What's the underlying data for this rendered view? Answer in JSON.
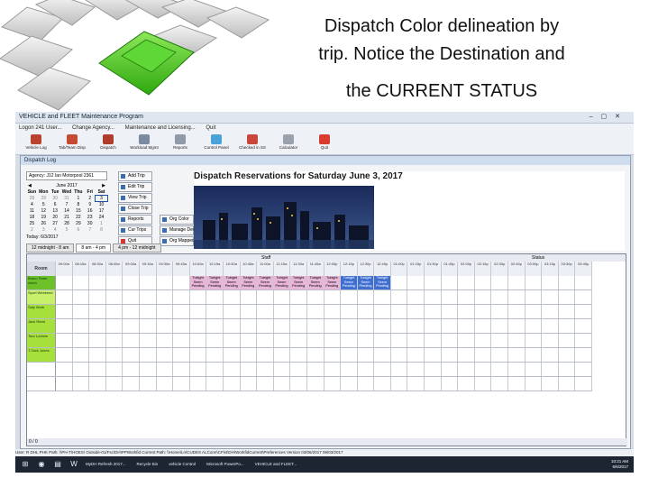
{
  "slide": {
    "title_line1": "Dispatch Color delineation by",
    "title_line2": "trip. Notice the Destination and",
    "title_line3": "the CURRENT STATUS"
  },
  "app": {
    "title": "VEHICLE and FLEET Maintenance Program",
    "menu": [
      "Logon 241 User...",
      "Change Agency...",
      "Maintenance and Licensing...",
      "Quit"
    ],
    "toolbar": [
      "Vehicle Log",
      "Tab/Team Disp",
      "Dispatch",
      "Workload Mgmt",
      "Reports",
      "Control Panel",
      "Checked in SS",
      "Calculator",
      "Quit"
    ]
  },
  "dispatch": {
    "window_title": "Dispatch Log",
    "agency": "Agency: J12 Ian Motorpool 2361",
    "month": "June 2017",
    "weekdays": [
      "Sun",
      "Mon",
      "Tue",
      "Wed",
      "Thu",
      "Fri",
      "Sat"
    ],
    "days": [
      "28",
      "29",
      "30",
      "31",
      "1",
      "2",
      "3",
      "4",
      "5",
      "6",
      "7",
      "8",
      "9",
      "10",
      "11",
      "12",
      "13",
      "14",
      "15",
      "16",
      "17",
      "18",
      "19",
      "20",
      "21",
      "22",
      "23",
      "24",
      "25",
      "26",
      "27",
      "28",
      "29",
      "30",
      "1",
      "2",
      "3",
      "4",
      "5",
      "6",
      "7",
      "8"
    ],
    "today_label": "Today: 6/3/2017",
    "buttons": [
      "Add Trip",
      "Edit Trip",
      "View Trip",
      "Close Trip",
      "Reports",
      "Org Color",
      "Cur Trips",
      "Manage Dev",
      "Quit",
      "Org Mapped"
    ],
    "heading": "Dispatch Reservations for Saturday",
    "heading_date": "June 3, 2017",
    "time_tabs": [
      "12 midnight - 8 am",
      "8 am - 4 pm",
      "4 pm - 12 midnight"
    ],
    "legend_left": "Staff",
    "legend_right": "Status",
    "first_col": "Room",
    "times": [
      "09:00a",
      "08:15a",
      "08:30a",
      "08:45a",
      "09:00a",
      "09:15a",
      "09:30a",
      "09:45a",
      "10:00a",
      "10:15a",
      "10:30a",
      "10:45a",
      "11:00a",
      "11:15a",
      "11:30a",
      "11:45a",
      "12:00p",
      "12:15p",
      "12:30p",
      "12:45p",
      "01:00p",
      "01:15p",
      "01:30p",
      "01:45p",
      "02:00p",
      "02:15p",
      "02:30p",
      "02:45p",
      "03:00p",
      "03:15p",
      "03:30p",
      "03:45p"
    ],
    "rows": [
      {
        "label": "Bravo Team mech"
      },
      {
        "label": "Sport Weekend"
      },
      {
        "label": "Saly Work"
      },
      {
        "label": "Jack Reed"
      },
      {
        "label": "Tour Lodmm"
      },
      {
        "label": "T-Tack Jones"
      },
      {
        "label": ""
      },
      {
        "label": ""
      }
    ],
    "trip_cell_text": "Tubight Seem Pending",
    "current_cell_text": "Tubight Seem Pending",
    "grid_footer": "0 / 0"
  },
  "statusbar": "User: R DHL PHK    Path: \\\\PH-T\\HOES\\    Outside-01/Fsc\\DH\\PPWorkfid Current    Path: \\\\Home\\Ln\\CUDES ALConn\\CFlxt\\DH\\WorkfidCurrent\\Preferences    Version 03/06/2017    06/03/2017",
  "taskbar": {
    "items": [
      "MyDH Refresh 2017...",
      "Recycle Bin",
      "vehicle Control",
      "Microsoft PowerPo...",
      "VEHICLE and FLEET..."
    ],
    "time": "10:21 AM",
    "date": "6/6/2017"
  },
  "colors": {
    "car_green": "#39c21a",
    "trip_pink": "#e9b6d8",
    "current_blue": "#3f6fd0",
    "row_green": "#66cc22"
  }
}
